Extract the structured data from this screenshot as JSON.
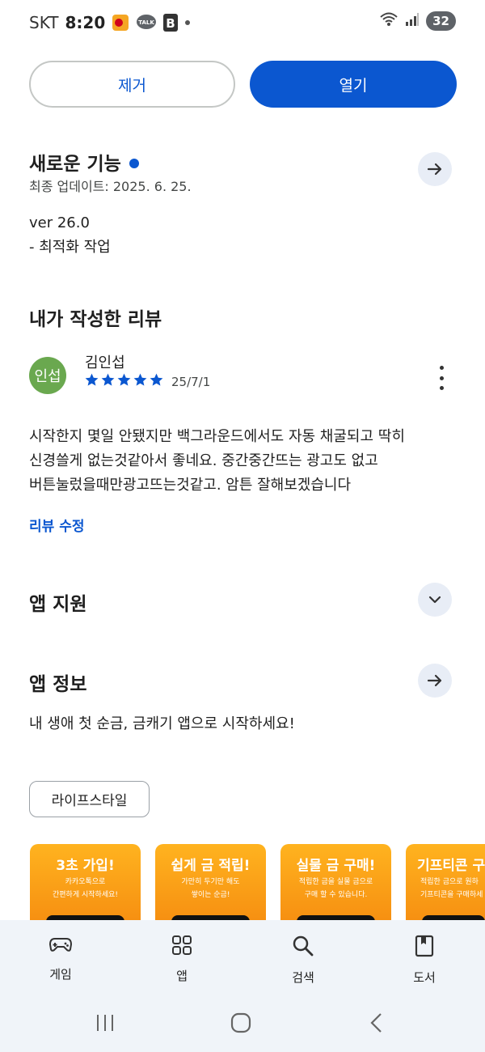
{
  "status_bar": {
    "carrier": "SKT",
    "time": "8:20",
    "talk_label": "TALK",
    "b_label": "B",
    "battery": "32"
  },
  "actions": {
    "remove_label": "제거",
    "open_label": "열기"
  },
  "whats_new": {
    "title": "새로운 기능",
    "updated": "최종 업데이트: 2025. 6. 25.",
    "version": "ver 26.0",
    "note": "- 최적화 작업"
  },
  "my_review": {
    "title": "내가 작성한 리뷰",
    "avatar_text": "인섭",
    "reviewer": "김인섭",
    "rating": 5,
    "date": "25/7/1",
    "lines": [
      "시작한지 몇일 안됐지만 백그라운드에서도 자동 채굴되고 딱히",
      "신경쓸게 없는것같아서 좋네요. 중간중간뜨는 광고도 없고",
      "버튼눌렀을때만광고뜨는것같고. 암튼 잘해보겠습니다"
    ],
    "edit_label": "리뷰 수정"
  },
  "app_support": {
    "title": "앱 지원"
  },
  "app_info": {
    "title": "앱 정보",
    "description": "내 생애 첫 순금, 금캐기 앱으로 시작하세요!",
    "category_chip": "라이프스타일"
  },
  "screenshots": [
    {
      "title": "3초 가입!",
      "sub1": "카카오톡으로",
      "sub2": "간편하게 시작하세요!"
    },
    {
      "title": "쉽게 금 적립!",
      "sub1": "가만히 두기만 해도",
      "sub2": "쌓이는 순금!"
    },
    {
      "title": "실물 금 구매!",
      "sub1": "적립한 금을 실물 금으로",
      "sub2": "구매 할 수 있습니다."
    },
    {
      "title": "기프티콘 구",
      "sub1": "적립한 금으로 원하",
      "sub2": "기프티콘을 구매하세"
    }
  ],
  "bottom_nav": [
    {
      "label": "게임",
      "icon": "gamepad-icon"
    },
    {
      "label": "앱",
      "icon": "apps-grid-icon"
    },
    {
      "label": "검색",
      "icon": "search-icon"
    },
    {
      "label": "도서",
      "icon": "book-icon"
    }
  ],
  "colors": {
    "accent": "#0b57d0",
    "nav_bg": "#f0f4f9",
    "avatar": "#6aa84f",
    "screenshot_orange": "#f99a14"
  }
}
